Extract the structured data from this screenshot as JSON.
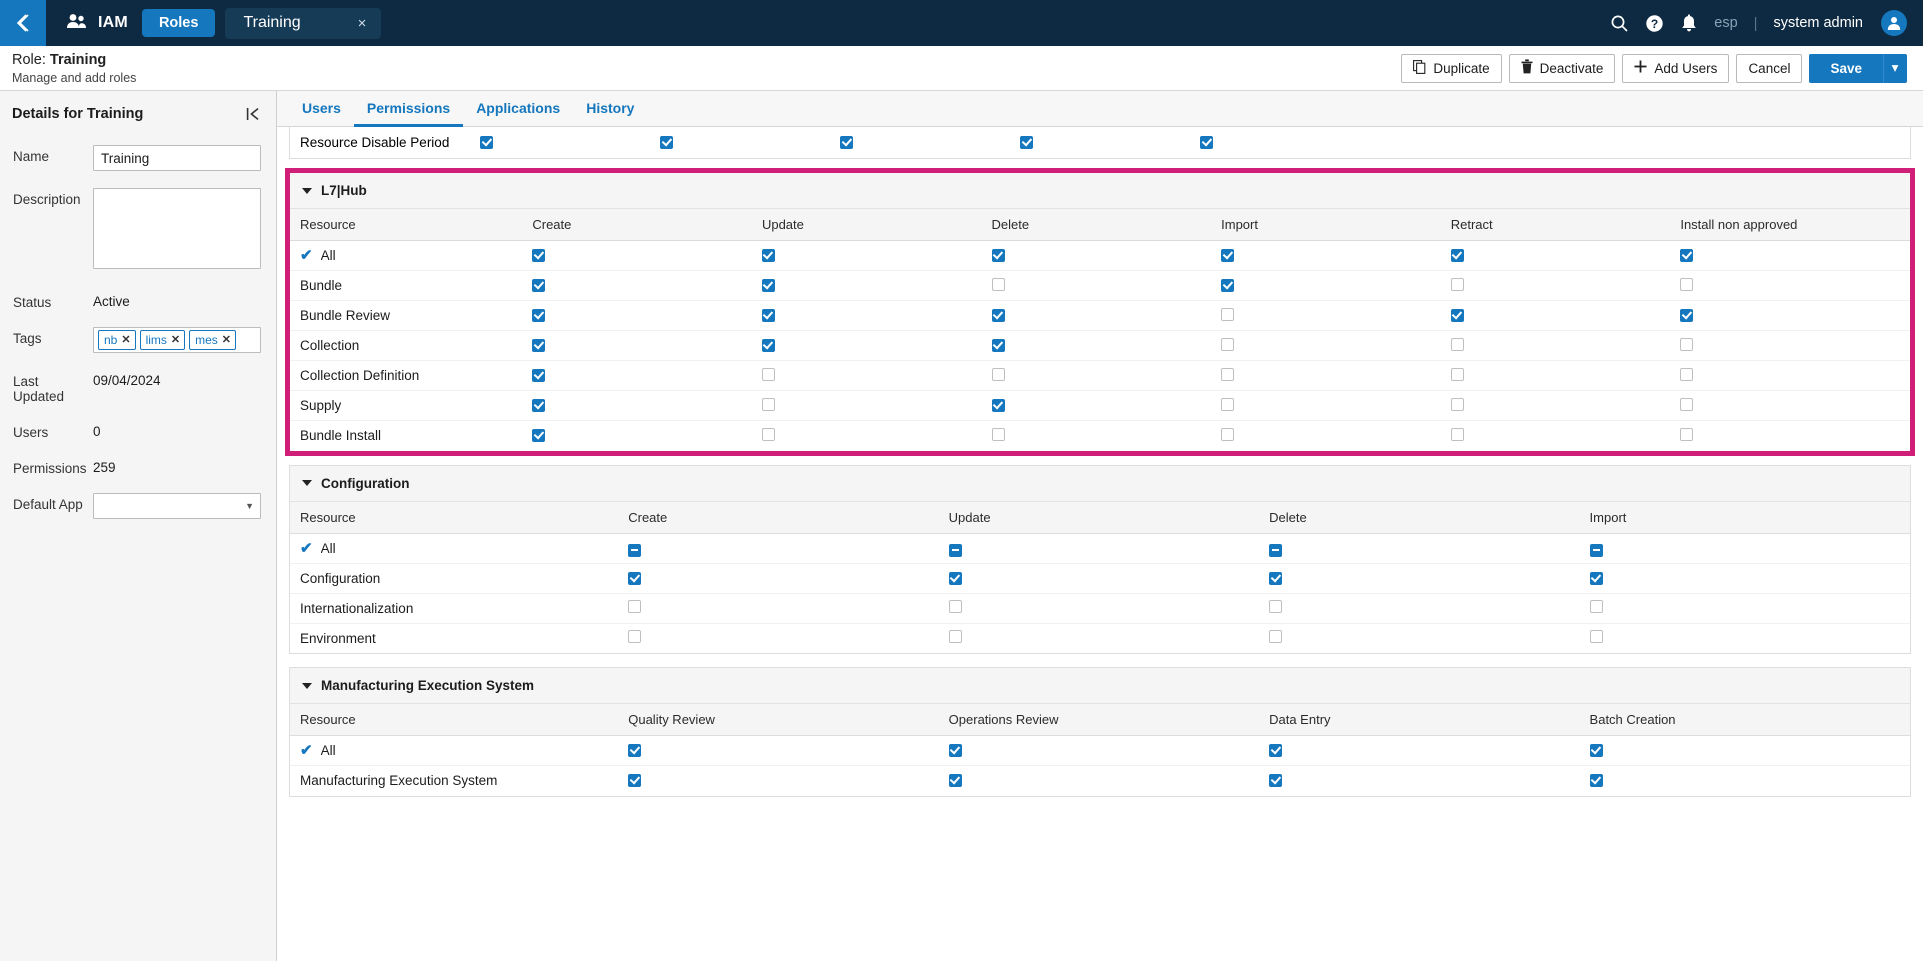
{
  "topnav": {
    "back_icon": "chevron-left-icon",
    "app_icon": "users-icon",
    "app_label": "IAM",
    "module_pill": "Roles",
    "open_tab": "Training",
    "tab_close": "×",
    "search_icon": "search-icon",
    "help_icon": "help-icon",
    "notifications_icon": "bell-icon",
    "language": "esp",
    "separator": "|",
    "user": "system admin",
    "avatar_icon": "user-avatar-icon"
  },
  "pagehead": {
    "title_prefix": "Role:",
    "title_value": "Training",
    "subtitle": "Manage and add roles",
    "actions": {
      "duplicate": "Duplicate",
      "deactivate": "Deactivate",
      "add_users": "Add Users",
      "cancel": "Cancel",
      "save": "Save",
      "save_dropdown": "▾"
    }
  },
  "details": {
    "title": "Details for Training",
    "collapse_icon": "collapse-panel-icon",
    "fields": {
      "name_label": "Name",
      "name_value": "Training",
      "description_label": "Description",
      "description_value": "",
      "status_label": "Status",
      "status_value": "Active",
      "tags_label": "Tags",
      "tags": [
        "nb",
        "lims",
        "mes"
      ],
      "tag_remove": "✕",
      "last_updated_label": "Last Updated",
      "last_updated_value": "09/04/2024",
      "users_label": "Users",
      "users_value": "0",
      "permissions_label": "Permissions",
      "permissions_value": "259",
      "default_app_label": "Default App",
      "default_app_value": ""
    }
  },
  "tabs": [
    {
      "label": "Users",
      "active": false
    },
    {
      "label": "Permissions",
      "active": true
    },
    {
      "label": "Applications",
      "active": false
    },
    {
      "label": "History",
      "active": false
    }
  ],
  "partial_row": {
    "resource": "Resource Disable Period",
    "checks": [
      true,
      true,
      true,
      true,
      true
    ]
  },
  "colors": {
    "accent": "#1577bd",
    "highlight": "#cf1f78",
    "navbar": "#0e2a42",
    "panel": "#f5f5f5"
  },
  "sections": [
    {
      "title": "L7|Hub",
      "highlighted": true,
      "columns": [
        "Resource",
        "Create",
        "Update",
        "Delete",
        "Import",
        "Retract",
        "Install non approved"
      ],
      "rows": [
        {
          "resource": "All",
          "is_all": true,
          "checks": [
            "on",
            "on",
            "on",
            "on",
            "on",
            "on"
          ]
        },
        {
          "resource": "Bundle",
          "is_all": false,
          "checks": [
            "on",
            "on",
            "off",
            "on",
            "off",
            "off"
          ]
        },
        {
          "resource": "Bundle Review",
          "is_all": false,
          "checks": [
            "on",
            "on",
            "on",
            "off",
            "on",
            "on"
          ]
        },
        {
          "resource": "Collection",
          "is_all": false,
          "checks": [
            "on",
            "on",
            "on",
            "off",
            "off",
            "off"
          ]
        },
        {
          "resource": "Collection Definition",
          "is_all": false,
          "checks": [
            "on",
            "off",
            "off",
            "off",
            "off",
            "off"
          ]
        },
        {
          "resource": "Supply",
          "is_all": false,
          "checks": [
            "on",
            "off",
            "on",
            "off",
            "off",
            "off"
          ]
        },
        {
          "resource": "Bundle Install",
          "is_all": false,
          "checks": [
            "on",
            "off",
            "off",
            "off",
            "off",
            "off"
          ]
        }
      ]
    },
    {
      "title": "Configuration",
      "highlighted": false,
      "columns": [
        "Resource",
        "Create",
        "Update",
        "Delete",
        "Import"
      ],
      "rows": [
        {
          "resource": "All",
          "is_all": true,
          "checks": [
            "ind",
            "ind",
            "ind",
            "ind"
          ]
        },
        {
          "resource": "Configuration",
          "is_all": false,
          "checks": [
            "on",
            "on",
            "on",
            "on"
          ]
        },
        {
          "resource": "Internationalization",
          "is_all": false,
          "checks": [
            "off",
            "off",
            "off",
            "off"
          ]
        },
        {
          "resource": "Environment",
          "is_all": false,
          "checks": [
            "off",
            "off",
            "off",
            "off"
          ]
        }
      ]
    },
    {
      "title": "Manufacturing Execution System",
      "highlighted": false,
      "columns": [
        "Resource",
        "Quality Review",
        "Operations Review",
        "Data Entry",
        "Batch Creation"
      ],
      "rows": [
        {
          "resource": "All",
          "is_all": true,
          "checks": [
            "on",
            "on",
            "on",
            "on"
          ]
        },
        {
          "resource": "Manufacturing Execution System",
          "is_all": false,
          "checks": [
            "on",
            "on",
            "on",
            "on"
          ]
        }
      ]
    }
  ]
}
